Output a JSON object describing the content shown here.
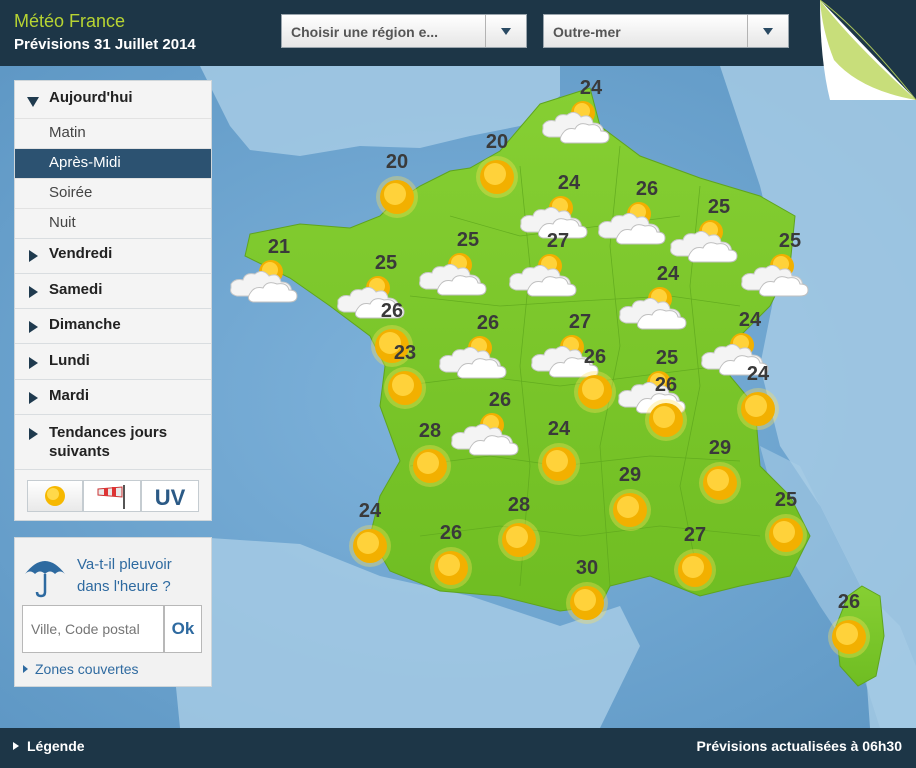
{
  "header": {
    "brand": "Météo France",
    "subtitle": "Prévisions 31 Juillet 2014",
    "region_select": "Choisir une région e...",
    "outremer_select": "Outre-mer"
  },
  "nav": {
    "today": "Aujourd'hui",
    "periods": [
      "Matin",
      "Après-Midi",
      "Soirée",
      "Nuit"
    ],
    "active_period": "Après-Midi",
    "days": [
      "Vendredi",
      "Samedi",
      "Dimanche",
      "Lundi",
      "Mardi"
    ],
    "trends_line1": "Tendances jours",
    "trends_line2": "suivants",
    "mode_uv": "UV"
  },
  "rain_widget": {
    "question_line1": "Va-t-il pleuvoir",
    "question_line2": "dans l'heure ?",
    "input_placeholder": "Ville, Code postal",
    "ok_label": "Ok",
    "zones_link": "Zones couvertes"
  },
  "footer": {
    "legend": "Légende",
    "updated": "Prévisions actualisées à 06h30"
  },
  "colors": {
    "header_bg": "#1d3647",
    "brand": "#b7d432",
    "land": "#7cc62b",
    "sea": "#6aa3cf",
    "active_item": "#2c5271"
  },
  "forecasts": [
    {
      "temp": "24",
      "icon": "partly-cloudy-icon"
    },
    {
      "temp": "20",
      "icon": "sun-icon"
    },
    {
      "temp": "20",
      "icon": "sun-icon"
    },
    {
      "temp": "24",
      "icon": "partly-cloudy-icon"
    },
    {
      "temp": "26",
      "icon": "partly-cloudy-icon"
    },
    {
      "temp": "25",
      "icon": "partly-cloudy-icon"
    },
    {
      "temp": "21",
      "icon": "partly-cloudy-icon"
    },
    {
      "temp": "25",
      "icon": "partly-cloudy-icon"
    },
    {
      "temp": "25",
      "icon": "partly-cloudy-icon"
    },
    {
      "temp": "27",
      "icon": "partly-cloudy-icon"
    },
    {
      "temp": "25",
      "icon": "partly-cloudy-icon"
    },
    {
      "temp": "24",
      "icon": "partly-cloudy-icon"
    },
    {
      "temp": "26",
      "icon": "sun-icon"
    },
    {
      "temp": "26",
      "icon": "partly-cloudy-icon"
    },
    {
      "temp": "27",
      "icon": "partly-cloudy-icon"
    },
    {
      "temp": "24",
      "icon": "partly-cloudy-icon"
    },
    {
      "temp": "25",
      "icon": "partly-cloudy-icon"
    },
    {
      "temp": "23",
      "icon": "sun-icon"
    },
    {
      "temp": "26",
      "icon": "partly-cloudy-icon"
    },
    {
      "temp": "26",
      "icon": "sun-icon"
    },
    {
      "temp": "26",
      "icon": "sun-icon"
    },
    {
      "temp": "24",
      "icon": "sun-icon"
    },
    {
      "temp": "28",
      "icon": "sun-icon"
    },
    {
      "temp": "24",
      "icon": "sun-icon"
    },
    {
      "temp": "29",
      "icon": "sun-icon"
    },
    {
      "temp": "29",
      "icon": "sun-icon"
    },
    {
      "temp": "28",
      "icon": "sun-icon"
    },
    {
      "temp": "24",
      "icon": "sun-icon"
    },
    {
      "temp": "26",
      "icon": "sun-icon"
    },
    {
      "temp": "25",
      "icon": "sun-icon"
    },
    {
      "temp": "27",
      "icon": "sun-icon"
    },
    {
      "temp": "30",
      "icon": "sun-icon"
    },
    {
      "temp": "26",
      "icon": "sun-icon"
    }
  ]
}
